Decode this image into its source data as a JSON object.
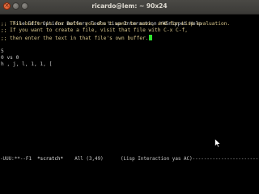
{
  "window": {
    "title": "ricardo@lem: ~ 90x24"
  },
  "menubar": {
    "items": [
      "File",
      "Edit",
      "Options",
      "Buffers",
      "Tools",
      "Lisp-Interaction",
      "YASnippet",
      "Help"
    ]
  },
  "buffer": {
    "lines": [
      ";; This buffer is for notes you don't want to save, and for Lisp evaluation.",
      ";; If you want to create a file, visit that file with C-x C-f,",
      ";; then enter the text in that file's own buffer.",
      "",
      "5",
      "0 vs 0",
      "h , j, l, 1, 1, ["
    ],
    "cursor_line": 2
  },
  "modeline": {
    "prefix": "-UUU:**--F1  ",
    "buffer_name": "*scratch*",
    "position": "All (3,49)",
    "modes": "(Lisp Interaction yas AC)",
    "fill": "-----------------------------------"
  },
  "icons": {
    "close": "close-icon",
    "minimize": "minimize-icon",
    "maximize": "maximize-icon",
    "pointer": "mouse-pointer-icon"
  }
}
